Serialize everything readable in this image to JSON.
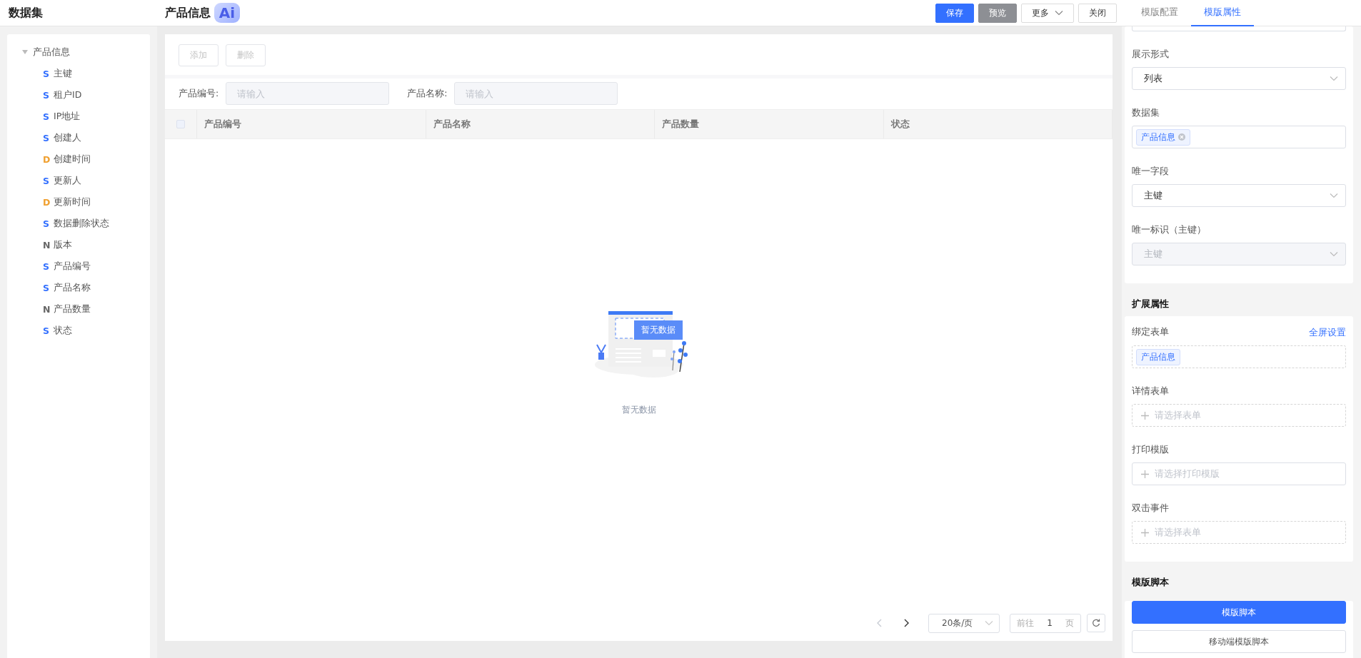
{
  "header": {
    "app_title": "数据集",
    "page_title": "产品信息",
    "ai_badge": "Ai",
    "buttons": [
      {
        "label": "保存",
        "kind": "primary"
      },
      {
        "label": "预览",
        "kind": "secondary"
      },
      {
        "label": "更多",
        "kind": "dropdown"
      },
      {
        "label": "关闭",
        "kind": "plain"
      }
    ],
    "tabs": [
      {
        "label": "模版配置",
        "selected": false
      },
      {
        "label": "模版属性",
        "selected": true
      }
    ]
  },
  "sidebar": {
    "tree": [
      {
        "label": "产品信息",
        "expanded": true,
        "children": [
          {
            "type_letter": "S",
            "kind": "string",
            "label": "主键"
          },
          {
            "type_letter": "S",
            "kind": "string",
            "label": "租户ID"
          },
          {
            "type_letter": "S",
            "kind": "string",
            "label": "IP地址"
          },
          {
            "type_letter": "S",
            "kind": "string",
            "label": "创建人"
          },
          {
            "type_letter": "D",
            "kind": "date",
            "label": "创建时间"
          },
          {
            "type_letter": "S",
            "kind": "string",
            "label": "更新人"
          },
          {
            "type_letter": "D",
            "kind": "date",
            "label": "更新时间"
          },
          {
            "type_letter": "S",
            "kind": "string",
            "label": "数据删除状态"
          },
          {
            "type_letter": "N",
            "kind": "number",
            "label": "版本"
          },
          {
            "type_letter": "S",
            "kind": "string",
            "label": "产品编号"
          },
          {
            "type_letter": "S",
            "kind": "string",
            "label": "产品名称"
          },
          {
            "type_letter": "N",
            "kind": "number",
            "label": "产品数量"
          },
          {
            "type_letter": "S",
            "kind": "string",
            "label": "状态"
          }
        ]
      }
    ]
  },
  "toolbar": {
    "buttons": [
      {
        "label": "添加",
        "disabled": true
      },
      {
        "label": "删除",
        "disabled": true
      }
    ]
  },
  "filters": [
    {
      "label": "产品编号:",
      "placeholder": "请输入"
    },
    {
      "label": "产品名称:",
      "placeholder": "请输入"
    }
  ],
  "table": {
    "select_all_checked": false,
    "columns": [
      "产品编号",
      "产品名称",
      "产品数量",
      "状态"
    ],
    "illustration_text": "暂无数据",
    "empty_text": "暂无数据"
  },
  "pagination": {
    "prev_disabled": true,
    "page_size": "20条/页",
    "goto_label": "前往",
    "page": "1",
    "page_unit": "页"
  },
  "properties": {
    "basic_fields": [
      {
        "label": "展示形式",
        "kind": "select",
        "value": "列表",
        "disabled": false
      },
      {
        "label": "数据集",
        "kind": "tags",
        "tags": [
          {
            "label": "产品信息",
            "closable": true
          }
        ]
      },
      {
        "label": "唯一字段",
        "kind": "select",
        "value": "主键",
        "disabled": false
      },
      {
        "label": "唯一标识（主键）",
        "kind": "select",
        "value": "主键",
        "disabled": true
      }
    ],
    "extended_title": "扩展属性",
    "extended_fields": [
      {
        "label": "绑定表单",
        "kind": "bound",
        "link": "全屏设置",
        "tags": [
          {
            "label": "产品信息",
            "closable": false
          }
        ]
      },
      {
        "label": "详情表单",
        "kind": "picker",
        "placeholder": "请选择表单",
        "dashed": true
      },
      {
        "label": "打印模版",
        "kind": "picker",
        "placeholder": "请选择打印模版",
        "dashed": false
      },
      {
        "label": "双击事件",
        "kind": "picker",
        "placeholder": "请选择表单",
        "dashed": true
      }
    ],
    "script_title": "模版脚本",
    "script_buttons": [
      {
        "label": "模版脚本",
        "kind": "primary"
      },
      {
        "label": "移动端模版脚本",
        "kind": "plain"
      }
    ]
  }
}
